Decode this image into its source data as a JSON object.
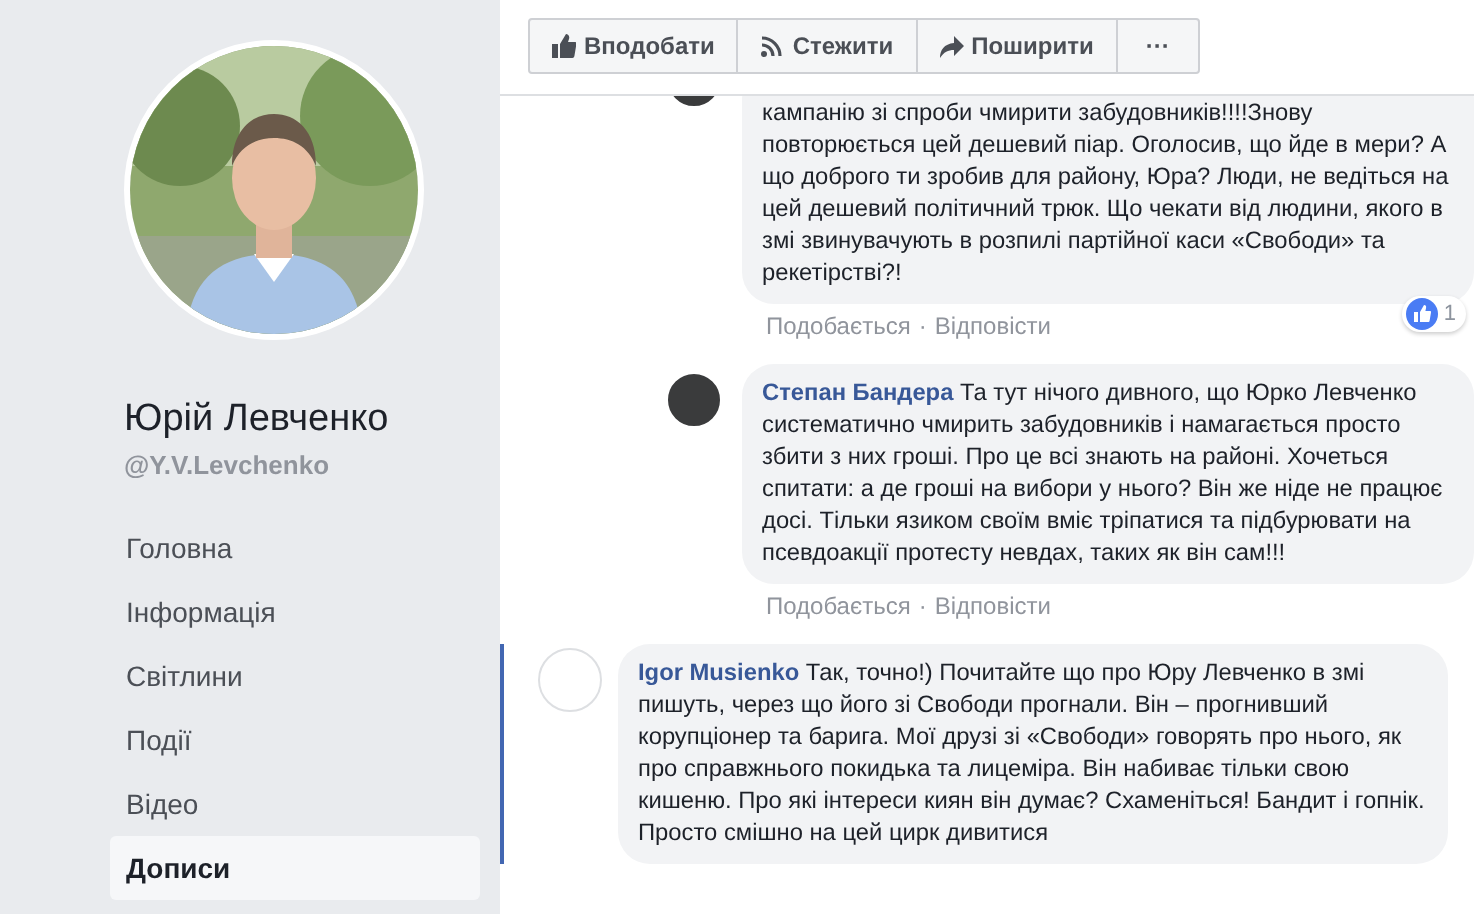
{
  "profile": {
    "name": "Юрій Левченко",
    "handle": "@Y.V.Levchenko"
  },
  "nav": [
    {
      "label": "Головна",
      "selected": false
    },
    {
      "label": "Інформація",
      "selected": false
    },
    {
      "label": "Світлини",
      "selected": false
    },
    {
      "label": "Події",
      "selected": false
    },
    {
      "label": "Відео",
      "selected": false
    },
    {
      "label": "Дописи",
      "selected": true
    }
  ],
  "actions": [
    {
      "kind": "like",
      "label": "Вподобати"
    },
    {
      "kind": "follow",
      "label": "Стежити"
    },
    {
      "kind": "share",
      "label": "Поширити"
    },
    {
      "kind": "more",
      "label": "···"
    }
  ],
  "comments": [
    {
      "highlighted": false,
      "text": "кампанію зі спроби чмирити забудовників!!!!Знову повторюється цей дешевий піар. Оголосив, що йде в мери? А що доброго ти зробив для району, Юра? Люди, не ведіться на цей дешевий політичний трюк. Що чекати від людини, якого в змі звинувачують в розпилі партійної каси «Свободи» та рекетірстві?!",
      "like_label": "Подобається",
      "separator": "·",
      "reply_label": "Відповісти",
      "reactions": "1"
    },
    {
      "highlighted": false,
      "author": "Степан Бандера",
      "text": "Та тут нічого дивного, що Юрко Левченко систематично чмирить забудовників і намагається просто збити з них гроші. Про це всі знають на районі. Хочеться спитати: а де гроші на вибори у нього? Він же ніде не працює досі. Тільки язиком своїм вміє тріпатися та підбурювати на псевдоакції протесту невдах, таких як він сам!!!",
      "like_label": "Подобається",
      "separator": "·",
      "reply_label": "Відповісти"
    },
    {
      "kind": "blank",
      "highlighted": true,
      "author": "Igor Musienko",
      "text": "Так, точно!) Почитайте що про Юру Левченко в змі пишуть, через що його зі Свободи прогнали. Він – прогнивший корупціонер та барига. Мої друзі зі «Свободи» говорять про нього, як про справжнього покидька та лицеміра. Він набиває тільки свою кишеню. Про які інтереси киян він думає? Схаменіться! Бандит і гопнік. Просто смішно на цей цирк дивитися"
    }
  ]
}
